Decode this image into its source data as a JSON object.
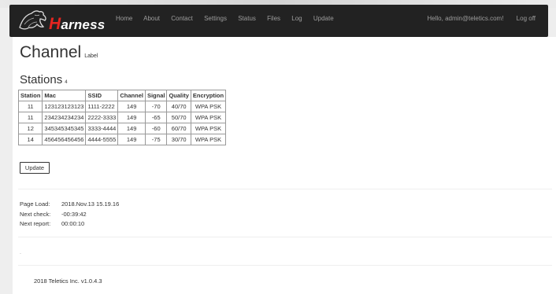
{
  "nav": {
    "brand_cap": "H",
    "brand_rest": "arness",
    "links": [
      "Home",
      "About",
      "Contact",
      "Settings",
      "Status",
      "Files",
      "Log",
      "Update"
    ],
    "greeting": "Hello, admin@teletics.com!",
    "logoff": "Log off"
  },
  "page": {
    "title": "Channel",
    "title_small": "Label",
    "stations_title": "Stations",
    "stations_count": "4"
  },
  "table": {
    "headers": [
      "Station",
      "Mac",
      "SSID",
      "Channel",
      "Signal",
      "Quality",
      "Encryption"
    ],
    "rows": [
      [
        "11",
        "123123123123",
        "1111-2222",
        "149",
        "-70",
        "40/70",
        "WPA PSK"
      ],
      [
        "11",
        "234234234234",
        "2222-3333",
        "149",
        "-65",
        "50/70",
        "WPA PSK"
      ],
      [
        "12",
        "345345345345",
        "3333-4444",
        "149",
        "-60",
        "60/70",
        "WPA PSK"
      ],
      [
        "14",
        "456456456456",
        "4444-5555",
        "149",
        "-75",
        "30/70",
        "WPA PSK"
      ]
    ]
  },
  "update_button": "Update",
  "info": {
    "page_load_label": "Page Load:",
    "page_load_value": "2018.Nov.13 15.19.16",
    "next_check_label": "Next check:",
    "next_check_value": "-00:39:42",
    "next_report_label": "Next report:",
    "next_report_value": "00:00:10"
  },
  "dot": ".",
  "footer": "2018 Teletics Inc. v1.0.4.3"
}
